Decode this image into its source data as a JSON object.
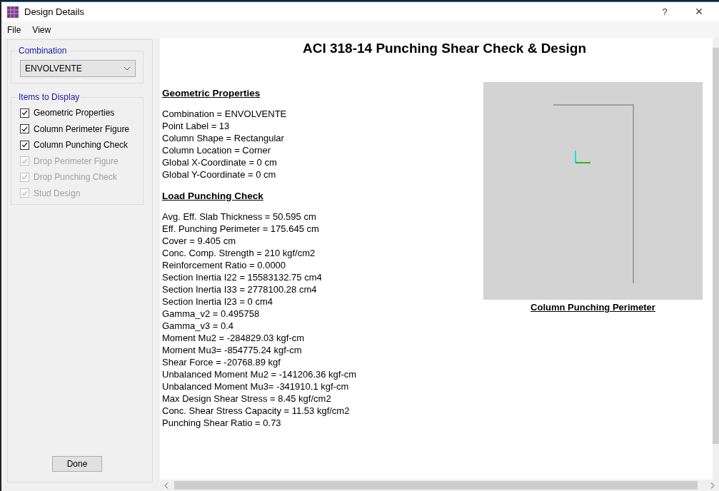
{
  "window": {
    "title": "Design Details",
    "help": "?",
    "close": "×"
  },
  "menu": [
    "File",
    "View"
  ],
  "sidebar": {
    "combination": {
      "label": "Combination",
      "value": "ENVOLVENTE"
    },
    "items_group": {
      "label": "Items to Display",
      "items": [
        {
          "label": "Geometric Properties",
          "checked": true,
          "disabled": false
        },
        {
          "label": "Column Perimeter Figure",
          "checked": true,
          "disabled": false
        },
        {
          "label": "Column Punching Check",
          "checked": true,
          "disabled": false
        },
        {
          "label": "Drop Perimeter Figure",
          "checked": true,
          "disabled": true
        },
        {
          "label": "Drop Punching Check",
          "checked": true,
          "disabled": true
        },
        {
          "label": "Stud Design",
          "checked": true,
          "disabled": true
        }
      ]
    },
    "done_button": "Done"
  },
  "report": {
    "title": "ACI 318-14 Punching Shear Check & Design",
    "sections": [
      {
        "heading": "Geometric Properties",
        "lines": [
          "Combination = ENVOLVENTE",
          "Point Label = 13",
          "Column Shape = Rectangular",
          "Column Location = Corner",
          "Global X-Coordinate = 0 cm",
          "Global Y-Coordinate = 0 cm"
        ]
      },
      {
        "heading": "Load Punching Check",
        "lines": [
          "Avg. Eff. Slab Thickness = 50.595 cm",
          "Eff. Punching Perimeter = 175.645 cm",
          "Cover = 9.405 cm",
          "Conc. Comp. Strength = 210 kgf/cm2",
          "Reinforcement Ratio = 0.0000",
          "Section Inertia I22 = 15583132.75 cm4",
          "Section Inertia I33 = 2778100.28 cm4",
          "Section Inertia I23 = 0 cm4",
          "Gamma_v2 = 0.495758",
          "Gamma_v3 = 0.4",
          "Moment Mu2 = -284829.03 kgf-cm",
          "Moment Mu3= -854775.24 kgf-cm",
          "Shear Force = -20768.89 kgf",
          "Unbalanced Moment Mu2 = -141206.36 kgf-cm",
          "Unbalanced Moment Mu3= -341910.1 kgf-cm",
          "Max Design Shear Stress = 8.45 kgf/cm2",
          "Conc. Shear Stress Capacity = 11.53 kgf/cm2",
          "Punching Shear Ratio = 0.73"
        ]
      }
    ],
    "figure_caption": "Column Punching Perimeter"
  }
}
